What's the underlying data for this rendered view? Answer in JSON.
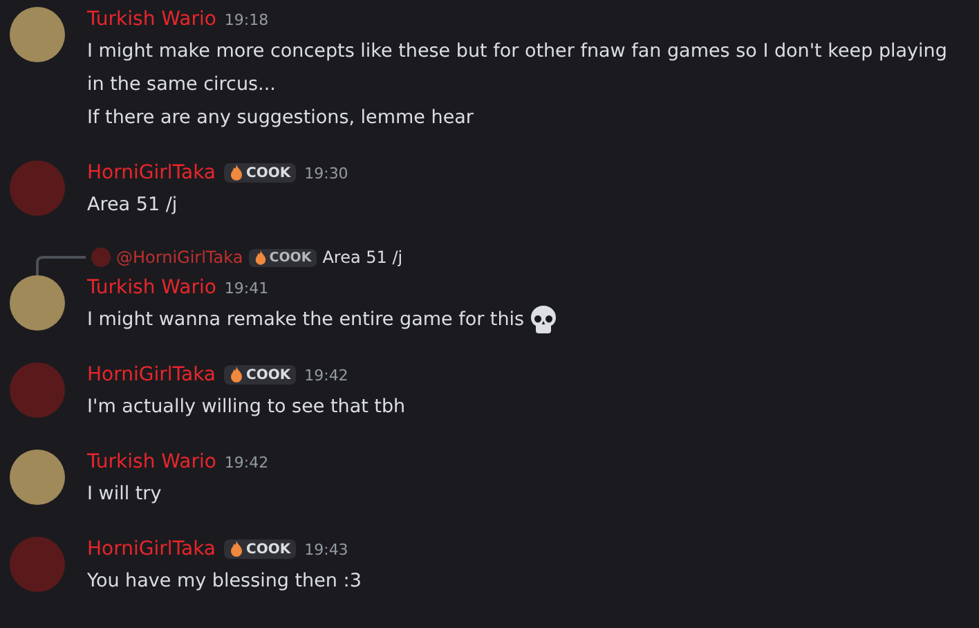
{
  "messages": [
    {
      "author": "Turkish Wario",
      "color": "#a08a5a",
      "time": "19:18",
      "lines": [
        {
          "kind": "text",
          "text": "I might make more concepts like these but for other fnaw fan games so I don't keep playing in the same circus..."
        },
        {
          "kind": "text",
          "text": "If there are any suggestions, lemme hear"
        }
      ]
    },
    {
      "author": "HorniGirlTaka",
      "color": "#5a1a1c",
      "tag": "COOK",
      "time": "19:30",
      "lines": [
        {
          "kind": "text",
          "text": "Area 51 /j"
        }
      ]
    },
    {
      "author": "Turkish Wario",
      "color": "#a08a5a",
      "time": "19:41",
      "reply": {
        "author": "@HorniGirlTaka",
        "color": "#5a1a1c",
        "tag": "COOK",
        "text": "Area 51 /j"
      },
      "lines": [
        {
          "kind": "skull",
          "text": "I might wanna remake the entire game for this"
        }
      ]
    },
    {
      "author": "HorniGirlTaka",
      "color": "#5a1a1c",
      "tag": "COOK",
      "time": "19:42",
      "lines": [
        {
          "kind": "text",
          "text": "I'm actually willing to see that tbh"
        }
      ]
    },
    {
      "author": "Turkish Wario",
      "color": "#a08a5a",
      "time": "19:42",
      "lines": [
        {
          "kind": "text",
          "text": "I will try"
        }
      ]
    },
    {
      "author": "HorniGirlTaka",
      "color": "#5a1a1c",
      "tag": "COOK",
      "time": "19:43",
      "lines": [
        {
          "kind": "text",
          "text": "You have my blessing then :3"
        }
      ]
    }
  ]
}
